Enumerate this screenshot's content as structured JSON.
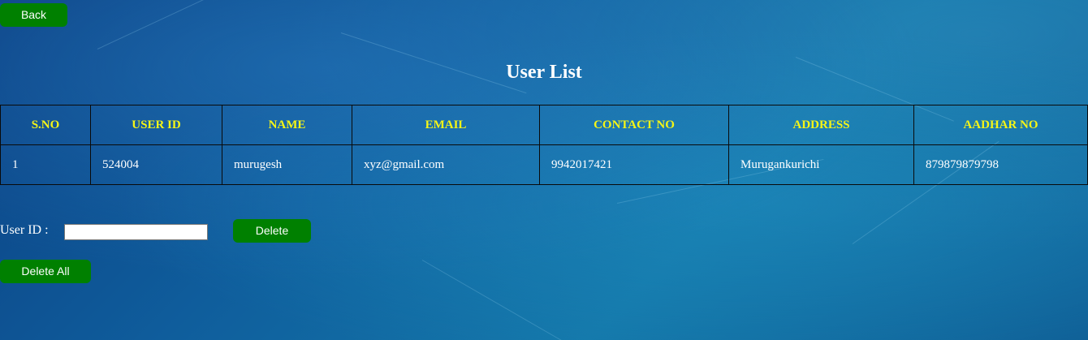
{
  "page": {
    "title": "User List",
    "back_label": "Back"
  },
  "table": {
    "headers": [
      "S.NO",
      "USER ID",
      "NAME",
      "EMAIL",
      "CONTACT NO",
      "ADDRESS",
      "AADHAR NO"
    ],
    "rows": [
      [
        "1",
        "524004",
        "murugesh",
        "xyz@gmail.com",
        "9942017421",
        "Murugankurichi",
        "879879879798"
      ]
    ]
  },
  "delete_form": {
    "label": "User ID :",
    "input_value": "",
    "delete_label": "Delete",
    "delete_all_label": "Delete All"
  },
  "colors": {
    "button_bg": "#008000",
    "header_text": "#f5f516",
    "body_text": "#ffffff"
  }
}
